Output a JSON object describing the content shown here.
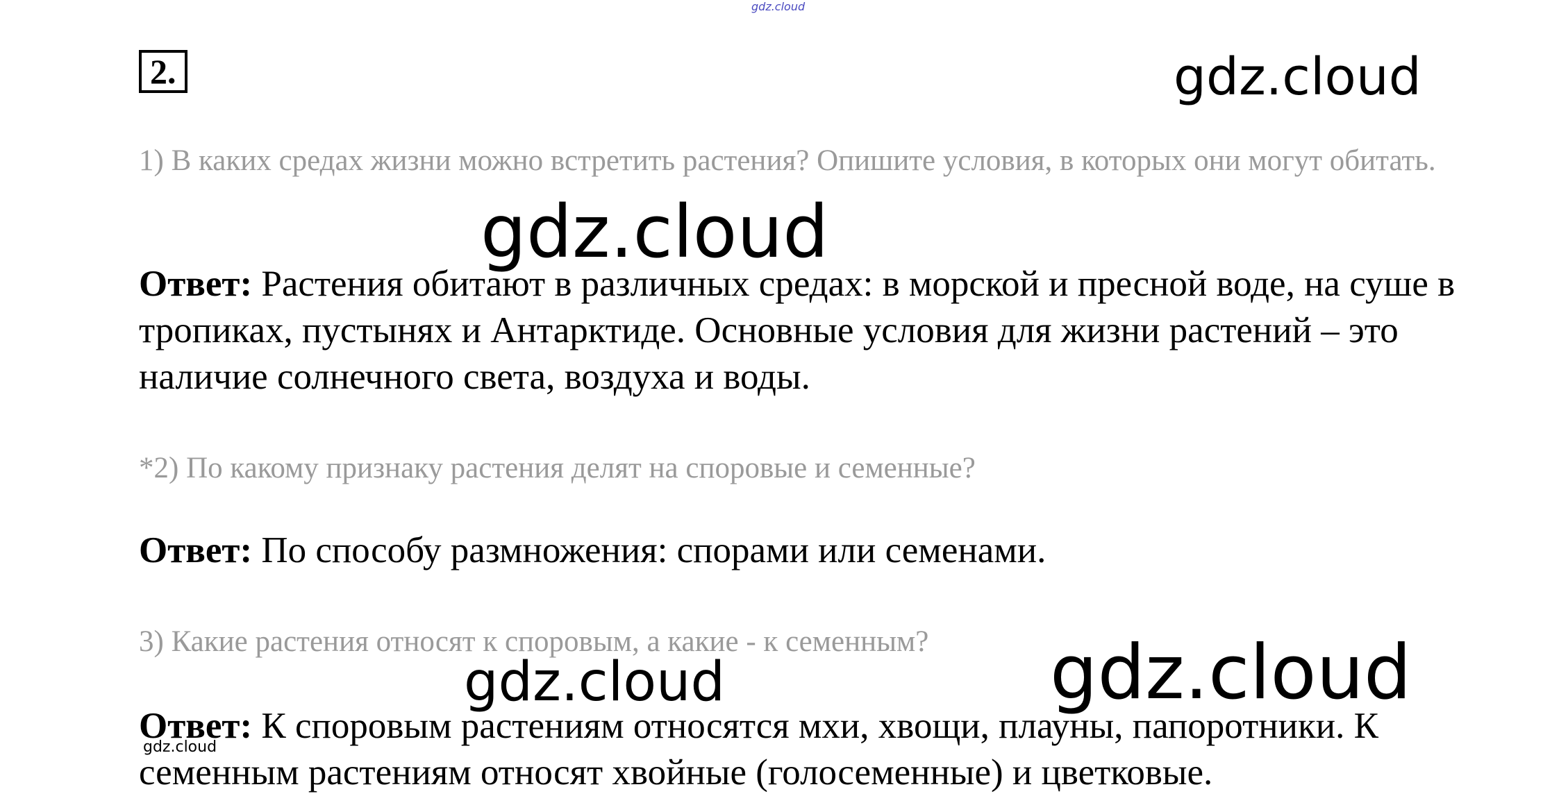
{
  "task_number": "2.",
  "watermarks": {
    "top_small": "gdz.cloud",
    "w1": "gdz.cloud",
    "w2": "gdz.cloud",
    "w3": "gdz.cloud",
    "w4": "gdz.cloud",
    "w5": "gdz.cloud"
  },
  "items": [
    {
      "question": "1) В каких средах жизни можно встретить растения? Опишите условия, в которых они могут обитать.",
      "answer_label": "Ответ:",
      "answer_text": " Растения обитают в различных средах: в морской и пресной воде, на суше в тропиках, пустынях и Антарктиде. Основные условия для жизни растений – это наличие солнечного света, воздуха и воды."
    },
    {
      "question": "*2) По какому признаку растения делят на споровые и семенные?",
      "answer_label": "Ответ:",
      "answer_text": " По способу размножения: спорами или семенами."
    },
    {
      "question": "3) Какие растения относят к споровым, а какие - к семенным?",
      "answer_label": "Ответ:",
      "answer_text": " К споровым растениям относятся мхи, хвощи, плауны, папоротники. К семенным растениям относят хвойные (голосеменные) и цветковые."
    }
  ]
}
